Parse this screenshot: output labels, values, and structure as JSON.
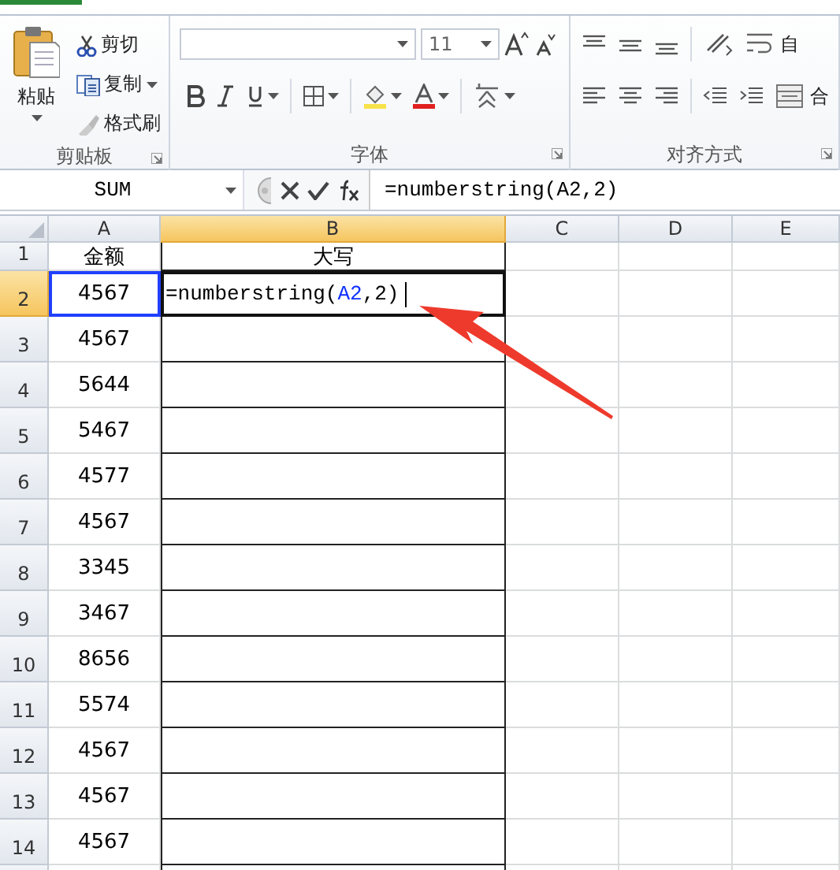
{
  "ribbon": {
    "clipboard": {
      "paste": "粘贴",
      "cut": "剪切",
      "copy": "复制",
      "format_painter": {
        "label": "格式刷",
        "disabled": true
      },
      "group_label": "剪贴板"
    },
    "font": {
      "font_size": "11",
      "group_label": "字体"
    },
    "alignment": {
      "wrap_text": "自",
      "merge": "合",
      "group_label": "对齐方式"
    }
  },
  "formula_bar": {
    "name_box": "SUM",
    "formula": "=numberstring(A2,2)"
  },
  "sheet": {
    "columns": [
      {
        "label": "A",
        "selected": false
      },
      {
        "label": "B",
        "selected": true
      },
      {
        "label": "C",
        "selected": false
      },
      {
        "label": "D",
        "selected": false
      },
      {
        "label": "E",
        "selected": false
      }
    ],
    "rows": [
      {
        "number": "1",
        "selected": false,
        "cells": [
          {
            "kind": "value",
            "text": "金额",
            "referenced": false
          },
          {
            "kind": "value",
            "text": "大写",
            "referenced": false
          }
        ]
      },
      {
        "number": "2",
        "selected": true,
        "cells": [
          {
            "kind": "value",
            "text": "4567",
            "referenced": true
          },
          {
            "kind": "formula",
            "prefix": "=numberstring(",
            "reference": "A2",
            "suffix": ",2)"
          }
        ]
      },
      {
        "number": "3",
        "selected": false,
        "cells": [
          {
            "kind": "value",
            "text": "4567",
            "referenced": false
          }
        ]
      },
      {
        "number": "4",
        "selected": false,
        "cells": [
          {
            "kind": "value",
            "text": "5644",
            "referenced": false
          }
        ]
      },
      {
        "number": "5",
        "selected": false,
        "cells": [
          {
            "kind": "value",
            "text": "5467",
            "referenced": false
          }
        ]
      },
      {
        "number": "6",
        "selected": false,
        "cells": [
          {
            "kind": "value",
            "text": "4577",
            "referenced": false
          }
        ]
      },
      {
        "number": "7",
        "selected": false,
        "cells": [
          {
            "kind": "value",
            "text": "4567",
            "referenced": false
          }
        ]
      },
      {
        "number": "8",
        "selected": false,
        "cells": [
          {
            "kind": "value",
            "text": "3345",
            "referenced": false
          }
        ]
      },
      {
        "number": "9",
        "selected": false,
        "cells": [
          {
            "kind": "value",
            "text": "3467",
            "referenced": false
          }
        ]
      },
      {
        "number": "10",
        "selected": false,
        "cells": [
          {
            "kind": "value",
            "text": "8656",
            "referenced": false
          }
        ]
      },
      {
        "number": "11",
        "selected": false,
        "cells": [
          {
            "kind": "value",
            "text": "5574",
            "referenced": false
          }
        ]
      },
      {
        "number": "12",
        "selected": false,
        "cells": [
          {
            "kind": "value",
            "text": "4567",
            "referenced": false
          }
        ]
      },
      {
        "number": "13",
        "selected": false,
        "cells": [
          {
            "kind": "value",
            "text": "4567",
            "referenced": false
          }
        ]
      },
      {
        "number": "14",
        "selected": false,
        "cells": [
          {
            "kind": "value",
            "text": "4567",
            "referenced": false
          }
        ]
      }
    ]
  }
}
